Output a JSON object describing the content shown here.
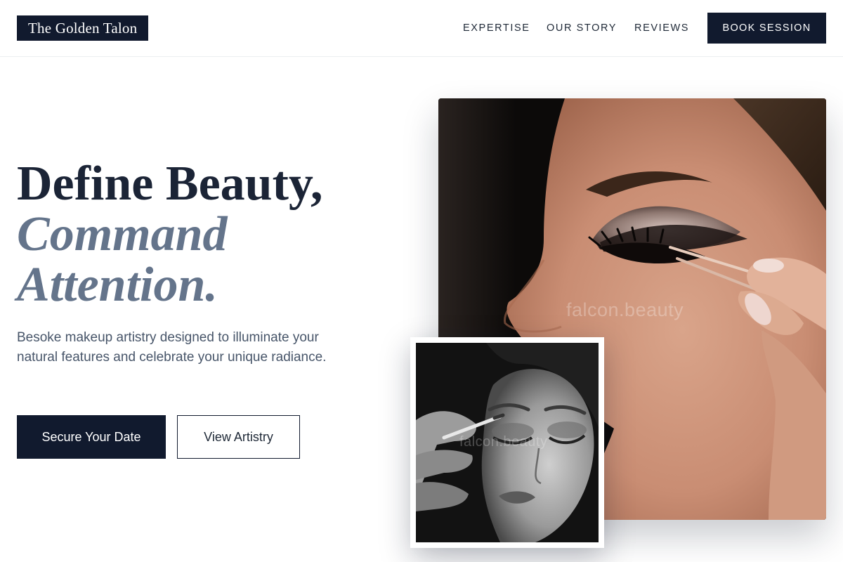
{
  "brand": {
    "name": "The Golden Talon"
  },
  "nav": {
    "items": [
      {
        "label": "EXPERTISE"
      },
      {
        "label": "OUR STORY"
      },
      {
        "label": "REVIEWS"
      }
    ],
    "cta_label": "BOOK SESSION"
  },
  "hero": {
    "headline_line1": "Define Beauty,",
    "headline_line2": "Command",
    "headline_line3": "Attention.",
    "subtitle": "Besoke makeup artistry designed to illuminate your natural features and celebrate your unique radiance.",
    "primary_button": "Secure Your Date",
    "secondary_button": "View Artistry"
  },
  "images": {
    "main_watermark": "falcon.beauty",
    "inset_watermark": "falcon.beauty"
  },
  "colors": {
    "navy": "#111a2e",
    "headline": "#1b2436",
    "accent_slate": "#64748b",
    "body_text": "#475569"
  }
}
